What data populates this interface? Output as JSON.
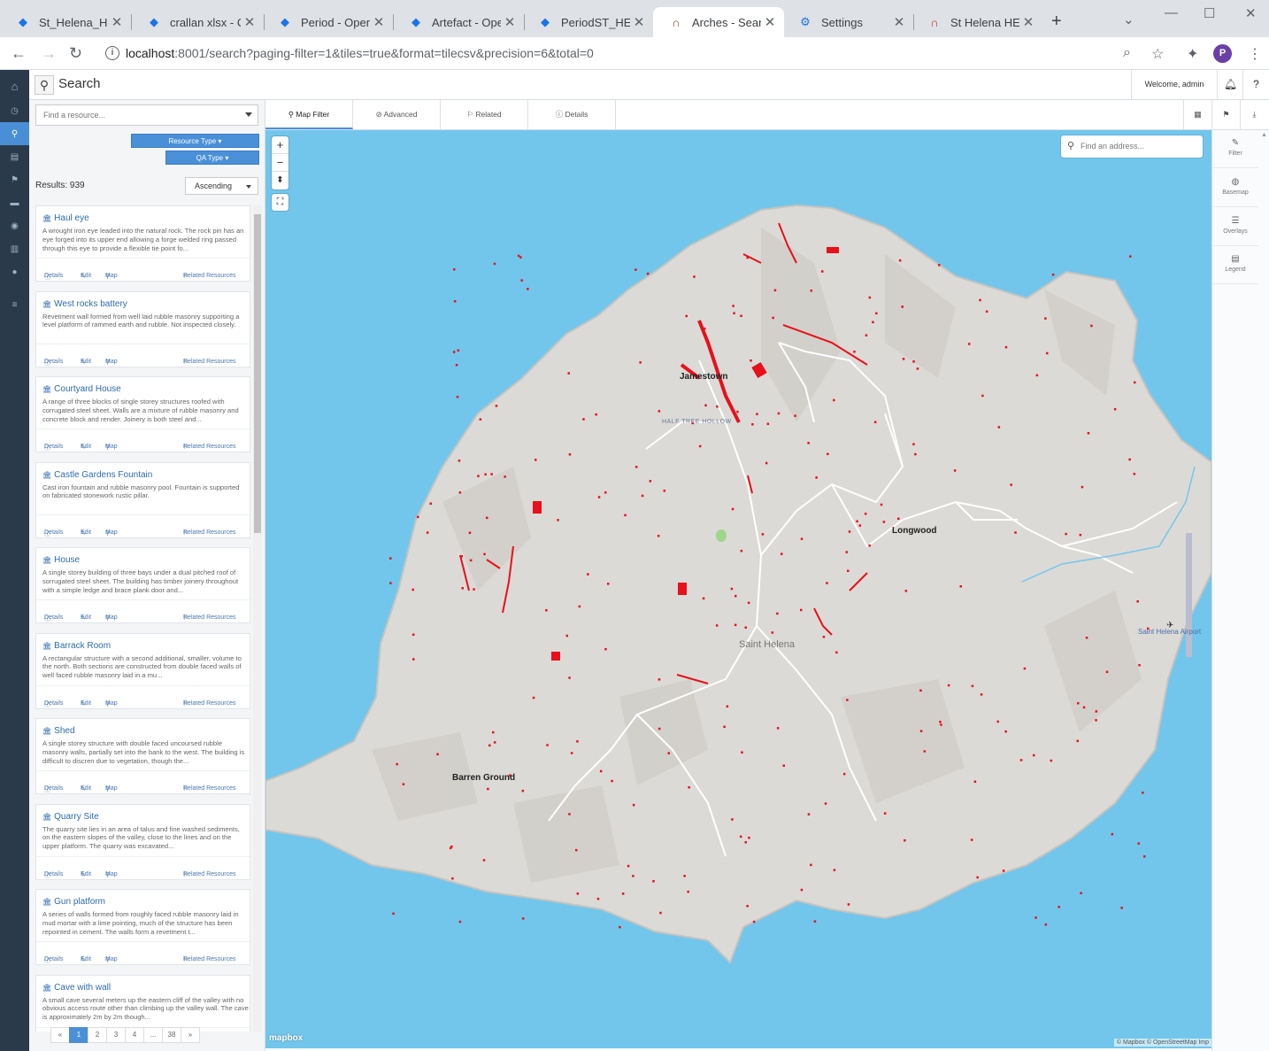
{
  "browser": {
    "tabs": [
      {
        "title": "St_Helena_Heri",
        "icon": "diamond-icon"
      },
      {
        "title": "crallan xlsx - Op",
        "icon": "diamond-icon"
      },
      {
        "title": "Period - OpenR",
        "icon": "diamond-icon"
      },
      {
        "title": "Artefact - Open",
        "icon": "diamond-icon"
      },
      {
        "title": "PeriodST_HEler",
        "icon": "diamond-icon"
      },
      {
        "title": "Arches - Search",
        "icon": "arches-icon",
        "active": true
      },
      {
        "title": "Settings",
        "icon": "gear-icon"
      },
      {
        "title": "St Helena HER",
        "icon": "arches-icon"
      }
    ],
    "url_host": "localhost",
    "url_rest": ":8001/search?paging-filter=1&tiles=true&format=tilecsv&precision=6&total=0",
    "profile_initial": "P"
  },
  "app": {
    "title": "Search",
    "welcome": "Welcome, admin",
    "find_resource_placeholder": "Find a resource...",
    "filter_buttons": [
      "Resource Type",
      "QA Type"
    ],
    "results_label": "Results: 939",
    "sort": "Ascending",
    "results": [
      {
        "title": "Haul eye",
        "desc": "A wrought iron eye leaded into the natural rock. The rock pin has an eye forged into its upper end allowing a forge welded ring passed through this eye to provide a flexible tie point fo..."
      },
      {
        "title": "West rocks battery",
        "desc": "Revetment wall formed from well laid rubble masonry supporting a level platform of rammed earth and rubble. Not inspected closely."
      },
      {
        "title": "Courtyard House",
        "desc": "A range of three blocks of single storey structures roofed with corrugated steel sheet. Walls are a mixture of rubble masonry and concrete block and render. Joinery is both steel and..."
      },
      {
        "title": "Castle Gardens Fountain",
        "desc": "Cast iron fountain and rubble masonry pool. Fountain is supported on fabricated stonework rustic pillar."
      },
      {
        "title": "House",
        "desc": "A single storey building of three bays under a dual pitched roof of sorrugated steel sheet. The building has timber joinery throughout with a simple ledge and brace plank door and..."
      },
      {
        "title": "Barrack Room",
        "desc": "A rectangular structure with a second additional, smaller, volume to the north. Both sections are constructed from double faced walls of well faced rubble masonry laid in a mu..."
      },
      {
        "title": "Shed",
        "desc": "A single storey structure with double faced uncoursed rubble masonry walls, partially set into the bank to the west. The building is difficult to discren due to vegetation, though the..."
      },
      {
        "title": "Quarry Site",
        "desc": "The quarry site lies in an area of talus and fine washed sediments, on the eastern slopes of the valley, close to the lines and on the upper platform. The quarry was excavated..."
      },
      {
        "title": "Gun platform",
        "desc": "A series of walls formed from roughly faced rubble masonry laid in mud mortar with a lime pointing, much of the structure has been repointed in cement. The walls form a revetment t..."
      },
      {
        "title": "Cave with wall",
        "desc": "A small cave several meters up the eastern cliff of the valley with no obvious access route other than climbing up the valley wall. The cave is approximately 2m by 2m though..."
      }
    ],
    "card_actions": {
      "details": "Details",
      "edit": "Edit",
      "map": "Map",
      "related": "Related Resources"
    },
    "pagination": [
      "«",
      "1",
      "2",
      "3",
      "4",
      "...",
      "38",
      "»"
    ],
    "map_tabs": [
      "Map Filter",
      "Advanced",
      "Related",
      "Details"
    ],
    "address_placeholder": "Find an address...",
    "map_controls": {
      "zoom_in": "+",
      "zoom_out": "−"
    },
    "map_labels": {
      "jamestown": "Jamestown",
      "half_tree_hollow": "HALF TREE HOLLOW",
      "longwood": "Longwood",
      "saint_helena": "Saint Helena",
      "barren_ground": "Barren Ground",
      "airport": "Saint Helena Airport"
    },
    "mapbox_logo": "mapbox",
    "attribution": "© Mapbox © OpenStreetMap Imp",
    "right_panel": [
      "Filter",
      "Basemap",
      "Overlays",
      "Legend"
    ]
  },
  "colors": {
    "accent": "#4a90d9",
    "sidebar": "#2b3a4a",
    "sea": "#72c6ec",
    "land": "#dcdad6",
    "features": "#e8101a"
  }
}
